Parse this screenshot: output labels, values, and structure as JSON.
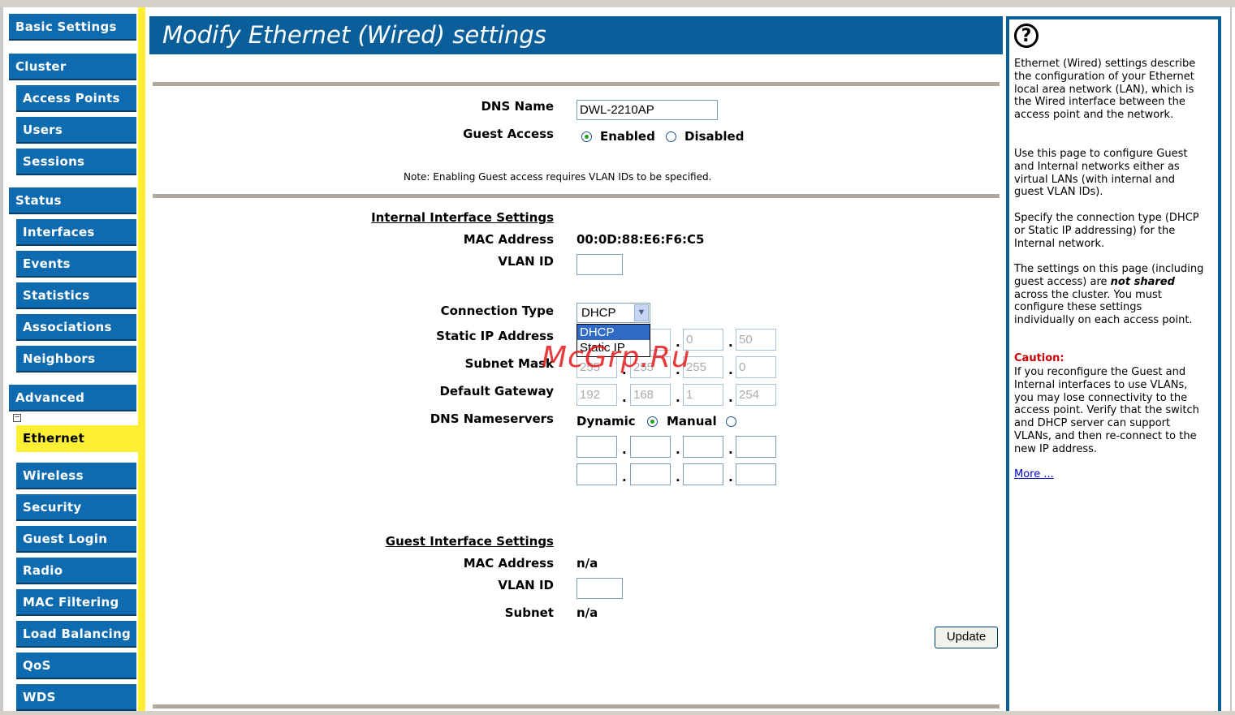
{
  "sidebar": {
    "items": [
      {
        "label": "Basic Settings"
      },
      {
        "label": "Cluster"
      },
      {
        "label": "Access Points"
      },
      {
        "label": "Users"
      },
      {
        "label": "Sessions"
      },
      {
        "label": "Status"
      },
      {
        "label": "Interfaces"
      },
      {
        "label": "Events"
      },
      {
        "label": "Statistics"
      },
      {
        "label": "Associations"
      },
      {
        "label": "Neighbors"
      },
      {
        "label": "Advanced"
      },
      {
        "label": "Ethernet"
      },
      {
        "label": "Wireless"
      },
      {
        "label": "Security"
      },
      {
        "label": "Guest Login"
      },
      {
        "label": "Radio"
      },
      {
        "label": "MAC Filtering"
      },
      {
        "label": "Load Balancing"
      },
      {
        "label": "QoS"
      },
      {
        "label": "WDS"
      }
    ],
    "active": "Ethernet",
    "colors": {
      "nav": "#0f6bb0",
      "active": "#ffef33"
    }
  },
  "header": {
    "title": "Modify Ethernet (Wired) settings"
  },
  "form": {
    "dns_name_label": "DNS Name",
    "dns_name_value": "DWL-2210AP",
    "guest_access_label": "Guest Access",
    "enabled_label": "Enabled",
    "disabled_label": "Disabled",
    "guest_access_value": "Enabled",
    "note": "Note: Enabling Guest access requires VLAN IDs to be specified.",
    "internal": {
      "section_title": "Internal Interface Settings",
      "mac_label": "MAC Address",
      "mac_value": "00:0D:88:E6:F6:C5",
      "vlan_label": "VLAN ID",
      "vlan_value": "",
      "connection_type_label": "Connection Type",
      "connection_type_value": "DHCP",
      "connection_type_options": [
        "DHCP",
        "Static IP"
      ],
      "static_ip_label": "Static IP Address",
      "static_ip": [
        "",
        "",
        "0",
        "50"
      ],
      "subnet_mask_label": "Subnet Mask",
      "subnet_mask": [
        "255",
        "255",
        "255",
        "0"
      ],
      "gateway_label": "Default Gateway",
      "gateway": [
        "192",
        "168",
        "1",
        "254"
      ],
      "dns_ns_label": "DNS Nameservers",
      "dynamic_label": "Dynamic",
      "manual_label": "Manual",
      "dns_mode": "Dynamic",
      "dns1": [
        "",
        "",
        "",
        ""
      ],
      "dns2": [
        "",
        "",
        "",
        ""
      ]
    },
    "guest": {
      "section_title": "Guest Interface Settings",
      "mac_label": "MAC Address",
      "mac_value": "n/a",
      "vlan_label": "VLAN ID",
      "vlan_value": "",
      "subnet_label": "Subnet",
      "subnet_value": "n/a"
    },
    "update_label": "Update"
  },
  "watermark": "McGrp.Ru",
  "help": {
    "icon": "help-question-icon",
    "p1": "Ethernet (Wired) settings describe the configuration of your Ethernet local area network (LAN), which is the Wired interface between the access point and the network.",
    "p2": "Use this page to configure Guest and Internal networks either as virtual LANs (with internal and guest VLAN IDs).",
    "p3": "Specify the connection type (DHCP or Static IP addressing) for the Internal network.",
    "p4_a": "The settings on this page (including guest access) are ",
    "p4_b": "not shared",
    "p4_c": " across the cluster. You must configure these settings individually on each access point.",
    "caution_title": "Caution:",
    "caution_text": "If you reconfigure the Guest and Internal interfaces to use VLANs, you may lose connectivity to the access point. Verify that the switch and DHCP server can support VLANs, and then re-connect to the new IP address.",
    "more_label": "More ..."
  }
}
